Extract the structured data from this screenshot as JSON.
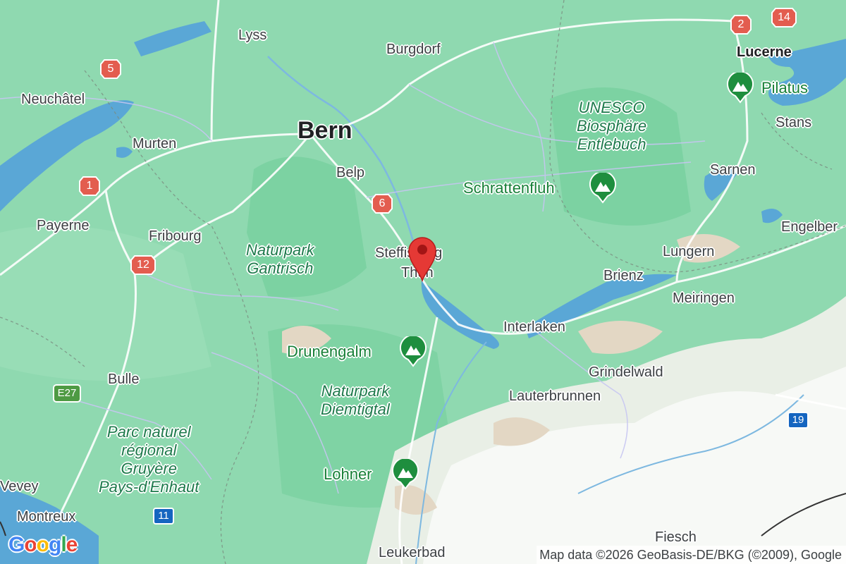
{
  "map": {
    "labels": {
      "lyss": "Lyss",
      "burgdorf": "Burgdorf",
      "lucerne": "Lucerne",
      "pilatus": "Pilatus",
      "neuchatel": "Neuchâtel",
      "bern": "Bern",
      "unesco": "UNESCO\nBiosphäre\nEntlebuch",
      "stans": "Stans",
      "murten": "Murten",
      "belp": "Belp",
      "sarnen": "Sarnen",
      "schrattenfluh": "Schrattenfluh",
      "payerne": "Payerne",
      "fribourg": "Fribourg",
      "engelberg": "Engelber",
      "naturpark_gantrisch": "Naturpark\nGantrisch",
      "steffisburg": "Steffisburg",
      "thun": "Thun",
      "lungern": "Lungern",
      "brienz": "Brienz",
      "meiringen": "Meiringen",
      "interlaken": "Interlaken",
      "drunengalm": "Drunengalm",
      "grindelwald": "Grindelwald",
      "bulle": "Bulle",
      "naturpark_diemtigtal": "Naturpark\nDiemtigtal",
      "lauterbrunnen": "Lauterbrunnen",
      "parc_gruyere": "Parc naturel\nrégional\nGruyère\nPays-d'Enhaut",
      "lohner": "Lohner",
      "vevey": "Vevey",
      "montreux": "Montreux",
      "fiesch": "Fiesch",
      "leukerbad": "Leukerbad"
    },
    "road_shields": {
      "r2": "2",
      "r14": "14",
      "r5": "5",
      "r1": "1",
      "r6": "6",
      "r12": "12",
      "e27": "E27",
      "r19": "19",
      "r11": "11"
    },
    "poi_icon": "mountain-icon",
    "marker_icon": "map-pin-icon",
    "logo_letters": [
      "G",
      "o",
      "o",
      "g",
      "l",
      "e"
    ],
    "logo_colors": [
      "#4285F4",
      "#EA4335",
      "#FBBC05",
      "#4285F4",
      "#34A853",
      "#EA4335"
    ],
    "attribution": "Map data ©2026 GeoBasis-DE/BKG (©2009), Google",
    "colors": {
      "land": "#8fd9b0",
      "forest": "#6fcf97",
      "water": "#5aa7d6",
      "mountain": "#ffffff",
      "marker": "#e53935",
      "route_shield": "#e53935"
    }
  }
}
